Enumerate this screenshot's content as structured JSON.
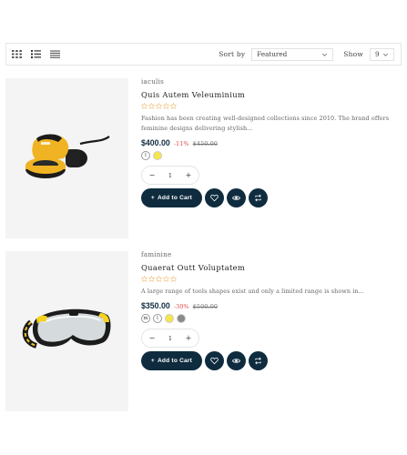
{
  "toolbar": {
    "sort_label": "Sort by",
    "sort_value": "Featured",
    "show_label": "Show",
    "show_value": "9"
  },
  "products": [
    {
      "category": "iaculis",
      "title": "Quis Autem Veleuminium",
      "rating": 0,
      "description": "Fashion has been creating well-designed collections since 2010. The brand offers feminine designs delivering stylish...",
      "price": "$400.00",
      "discount": "-11%",
      "old_price": "$450.00",
      "swatches": [
        {
          "label": "l",
          "color": "#ffffff"
        },
        {
          "label": "",
          "color": "#f5e64a"
        }
      ],
      "quantity": "1",
      "add_to_cart": "Add to Cart"
    },
    {
      "category": "faminine",
      "title": "Quaerat Outt Voluptatem",
      "rating": 0,
      "description": "A large range of tools shapes exist and only a limited range is shown in...",
      "price": "$350.00",
      "discount": "-30%",
      "old_price": "$500.00",
      "swatches": [
        {
          "label": "m",
          "color": "#ffffff"
        },
        {
          "label": "l",
          "color": "#ffffff"
        },
        {
          "label": "",
          "color": "#f5e64a"
        },
        {
          "label": "",
          "color": "#8a8a8a"
        }
      ],
      "quantity": "1",
      "add_to_cart": "Add to Cart"
    }
  ],
  "colors": {
    "primary": "#0f2c3f",
    "discount": "#e34b4b",
    "image_bg": "#f4f4f4"
  }
}
